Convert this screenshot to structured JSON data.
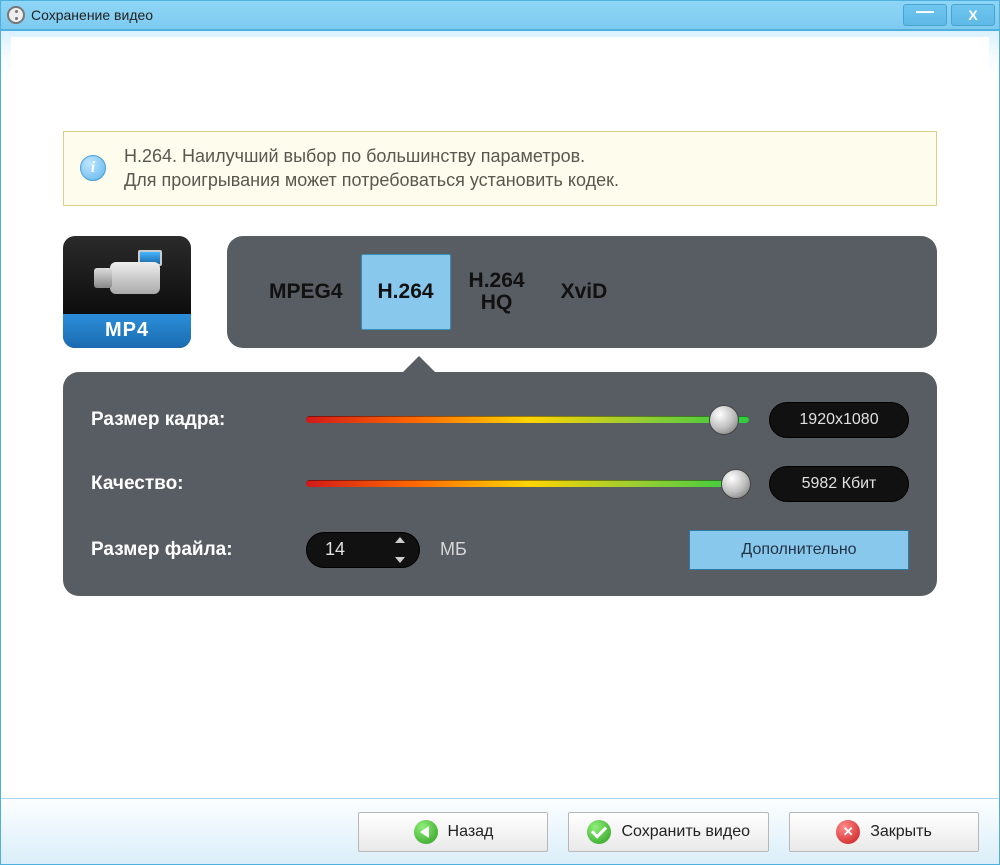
{
  "window": {
    "title": "Сохранение видео"
  },
  "info": {
    "line1": "H.264. Наилучший выбор по большинству параметров.",
    "line2": "Для проигрывания может потребоваться установить кодек."
  },
  "format": {
    "badge": "MP4"
  },
  "codecs": {
    "items": [
      "MPEG4",
      "H.264",
      "H.264\nHQ",
      "XviD"
    ],
    "selected_index": 1
  },
  "settings": {
    "frame_size": {
      "label": "Размер кадра:",
      "value": "1920x1080"
    },
    "quality": {
      "label": "Качество:",
      "value": "5982 Кбит"
    },
    "file_size": {
      "label": "Размер файла:",
      "value": "14",
      "unit": "МБ"
    },
    "advanced_label": "Дополнительно"
  },
  "buttons": {
    "back": "Назад",
    "save": "Сохранить видео",
    "close": "Закрыть"
  }
}
